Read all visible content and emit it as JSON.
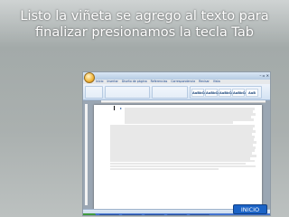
{
  "slide": {
    "title_line1": "Listo la viñeta se agrego al texto para",
    "title_line2": "finalizar presionamos la tecla Tab"
  },
  "word": {
    "window_title": "",
    "tabs": [
      "Inicio",
      "Insertar",
      "Diseño de página",
      "Referencias",
      "Correspondencia",
      "Revisar",
      "Vista"
    ],
    "styles": [
      "AaBbCcDc",
      "AaBbCcDc",
      "AaBbCc",
      "AaBbCc",
      "AaB"
    ],
    "status": ""
  },
  "nav": {
    "inicio_label": "INICIO"
  },
  "colors": {
    "bullet": "#2f5fa3",
    "inicio_button": "#1b63c6"
  }
}
